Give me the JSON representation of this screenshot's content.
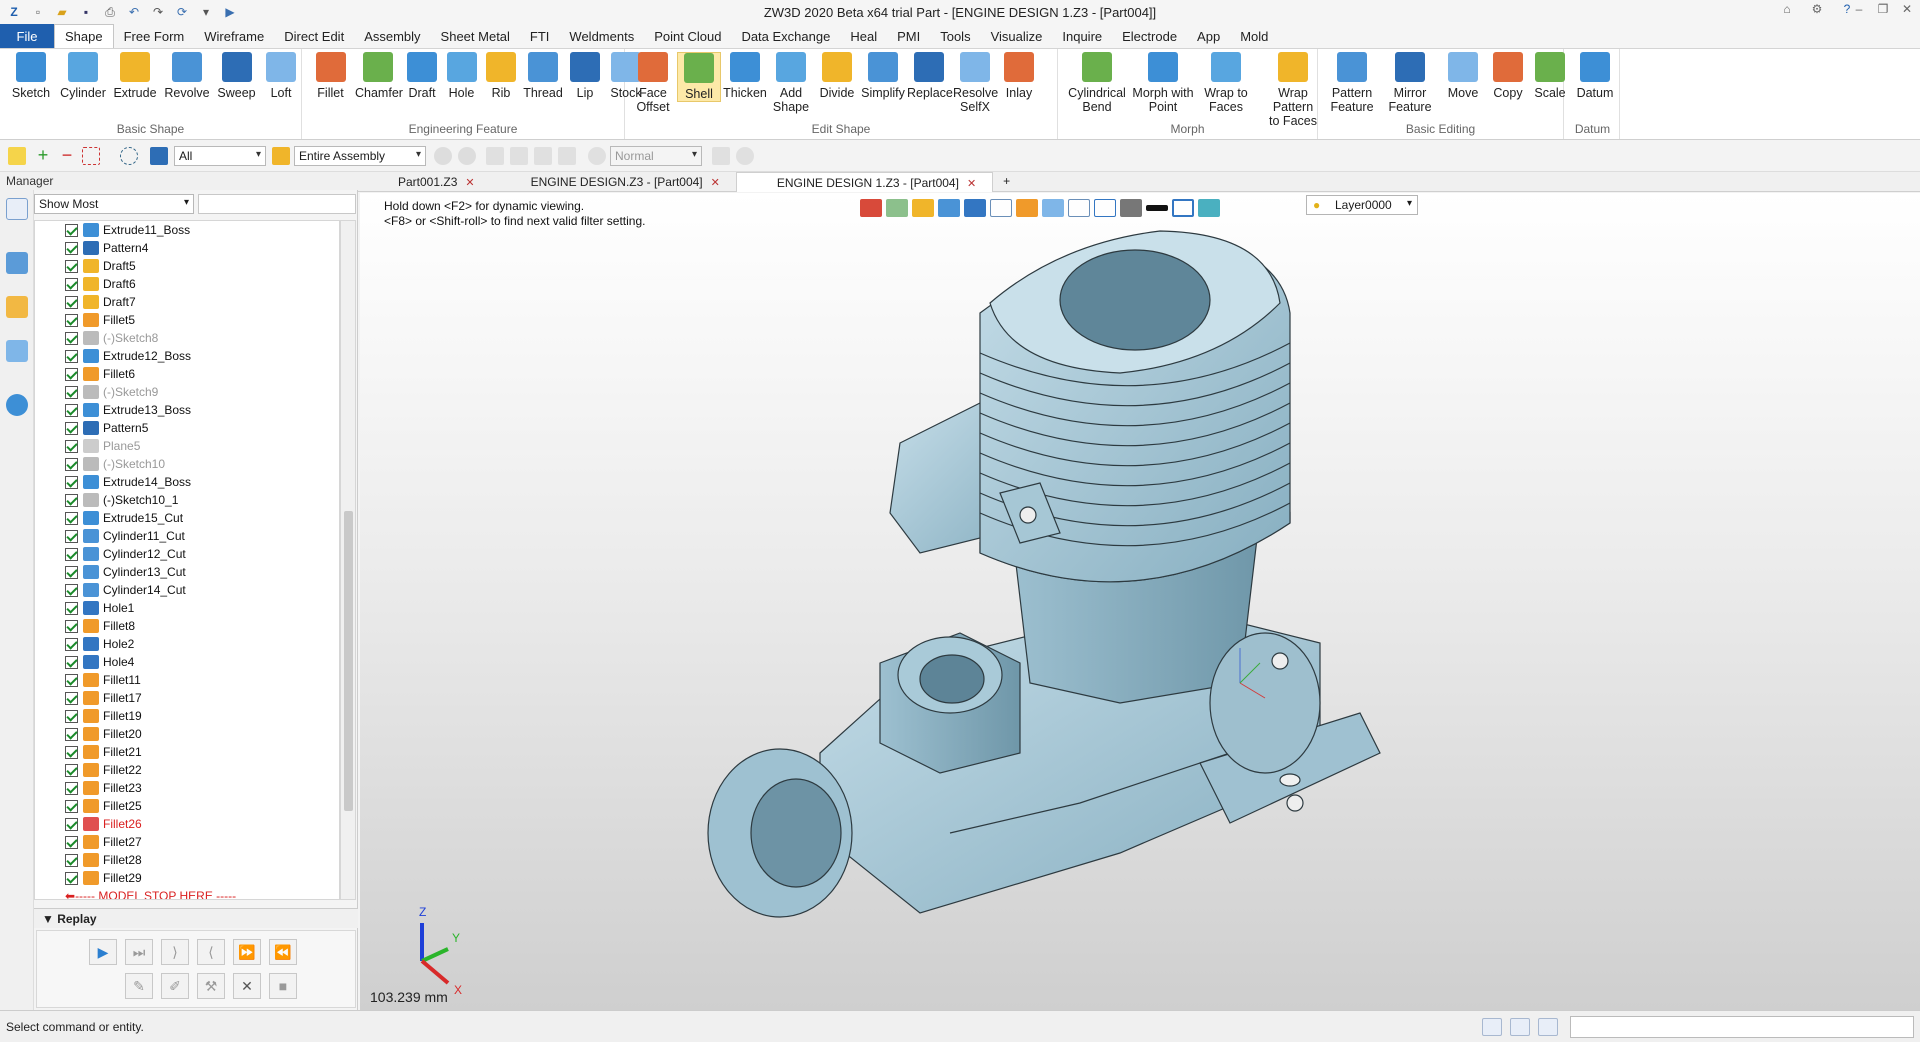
{
  "window": {
    "title": "ZW3D 2020 Beta x64 trial       Part - [ENGINE DESIGN 1.Z3 - [Part004]]"
  },
  "menu": [
    "File",
    "Shape",
    "Free Form",
    "Wireframe",
    "Direct Edit",
    "Assembly",
    "Sheet Metal",
    "FTI",
    "Weldments",
    "Point Cloud",
    "Data Exchange",
    "Heal",
    "PMI",
    "Tools",
    "Visualize",
    "Inquire",
    "Electrode",
    "App",
    "Mold"
  ],
  "menu_active": "Shape",
  "ribbon": {
    "groups": [
      {
        "label": "Basic Shape",
        "buttons": [
          "Sketch",
          "Cylinder",
          "Extrude",
          "Revolve",
          "Sweep",
          "Loft"
        ]
      },
      {
        "label": "Engineering Feature",
        "buttons": [
          "Fillet",
          "Chamfer",
          "Draft",
          "Hole",
          "Rib",
          "Thread",
          "Lip",
          "Stock"
        ]
      },
      {
        "label": "Edit Shape",
        "buttons": [
          "Face\nOffset",
          "Shell",
          "Thicken",
          "Add\nShape",
          "Divide",
          "Simplify",
          "Replace",
          "Resolve\nSelfX",
          "Inlay"
        ]
      },
      {
        "label": "Morph",
        "buttons": [
          "Cylindrical\nBend",
          "Morph with\nPoint",
          "Wrap to\nFaces",
          "Wrap Pattern\nto Faces"
        ]
      },
      {
        "label": "Basic Editing",
        "buttons": [
          "Pattern\nFeature",
          "Mirror\nFeature",
          "Move",
          "Copy",
          "Scale"
        ]
      },
      {
        "label": "Datum",
        "buttons": [
          "Datum"
        ]
      }
    ]
  },
  "toolbar": {
    "filter": "All",
    "scope": "Entire Assembly",
    "mode": "Normal"
  },
  "manager": {
    "title": "Manager",
    "show": "Show Most"
  },
  "tree": [
    {
      "label": "Extrude11_Boss",
      "icon": "extrude-icon",
      "state": "normal"
    },
    {
      "label": "Pattern4",
      "icon": "pattern-icon",
      "state": "normal"
    },
    {
      "label": "Draft5",
      "icon": "draft-icon",
      "state": "normal"
    },
    {
      "label": "Draft6",
      "icon": "draft-icon",
      "state": "normal"
    },
    {
      "label": "Draft7",
      "icon": "draft-icon",
      "state": "normal"
    },
    {
      "label": "Fillet5",
      "icon": "fillet-icon",
      "state": "normal"
    },
    {
      "label": "(-)Sketch8",
      "icon": "sketch-icon",
      "state": "dim"
    },
    {
      "label": "Extrude12_Boss",
      "icon": "extrude-icon",
      "state": "normal"
    },
    {
      "label": "Fillet6",
      "icon": "fillet-icon",
      "state": "normal"
    },
    {
      "label": "(-)Sketch9",
      "icon": "sketch-icon",
      "state": "dim"
    },
    {
      "label": "Extrude13_Boss",
      "icon": "extrude-icon",
      "state": "normal"
    },
    {
      "label": "Pattern5",
      "icon": "pattern-icon",
      "state": "normal"
    },
    {
      "label": "Plane5",
      "icon": "plane-icon",
      "state": "dim"
    },
    {
      "label": "(-)Sketch10",
      "icon": "sketch-icon",
      "state": "dim"
    },
    {
      "label": "Extrude14_Boss",
      "icon": "extrude-icon",
      "state": "normal"
    },
    {
      "label": "(-)Sketch10_1",
      "icon": "sketch-icon",
      "state": "normal"
    },
    {
      "label": "Extrude15_Cut",
      "icon": "extrude-icon",
      "state": "normal"
    },
    {
      "label": "Cylinder11_Cut",
      "icon": "cylinder-icon",
      "state": "normal"
    },
    {
      "label": "Cylinder12_Cut",
      "icon": "cylinder-icon",
      "state": "normal"
    },
    {
      "label": "Cylinder13_Cut",
      "icon": "cylinder-icon",
      "state": "normal"
    },
    {
      "label": "Cylinder14_Cut",
      "icon": "cylinder-icon",
      "state": "normal"
    },
    {
      "label": "Hole1",
      "icon": "hole-icon",
      "state": "normal"
    },
    {
      "label": "Fillet8",
      "icon": "fillet-icon",
      "state": "normal"
    },
    {
      "label": "Hole2",
      "icon": "hole-icon",
      "state": "normal"
    },
    {
      "label": "Hole4",
      "icon": "hole-icon",
      "state": "normal"
    },
    {
      "label": "Fillet11",
      "icon": "fillet-icon",
      "state": "normal"
    },
    {
      "label": "Fillet17",
      "icon": "fillet-icon",
      "state": "normal"
    },
    {
      "label": "Fillet19",
      "icon": "fillet-icon",
      "state": "normal"
    },
    {
      "label": "Fillet20",
      "icon": "fillet-icon",
      "state": "normal"
    },
    {
      "label": "Fillet21",
      "icon": "fillet-icon",
      "state": "normal"
    },
    {
      "label": "Fillet22",
      "icon": "fillet-icon",
      "state": "normal"
    },
    {
      "label": "Fillet23",
      "icon": "fillet-icon",
      "state": "normal"
    },
    {
      "label": "Fillet25",
      "icon": "fillet-icon",
      "state": "normal"
    },
    {
      "label": "Fillet26",
      "icon": "fillet-icon",
      "state": "err"
    },
    {
      "label": "Fillet27",
      "icon": "fillet-icon",
      "state": "normal"
    },
    {
      "label": "Fillet28",
      "icon": "fillet-icon",
      "state": "normal"
    },
    {
      "label": "Fillet29",
      "icon": "fillet-icon",
      "state": "normal"
    }
  ],
  "tree_stop": "----- MODEL STOP HERE -----",
  "replay": {
    "label": "Replay"
  },
  "tabs": [
    {
      "label": "Part001.Z3"
    },
    {
      "label": "ENGINE DESIGN.Z3 - [Part004]"
    },
    {
      "label": "ENGINE DESIGN 1.Z3 - [Part004]"
    }
  ],
  "tab_active": 2,
  "viewport": {
    "hint1": "Hold down <F2> for dynamic viewing.",
    "hint2": "<F8> or <Shift-roll> to find next valid filter setting.",
    "layer": "Layer0000",
    "scale": "103.239 mm",
    "axes": {
      "x": "X",
      "y": "Y",
      "z": "Z"
    }
  },
  "status": {
    "text": "Select command or entity."
  },
  "colors": {
    "file": "#1f5fae",
    "model": "#a9c9d8",
    "accent": "#3d8fd6"
  }
}
